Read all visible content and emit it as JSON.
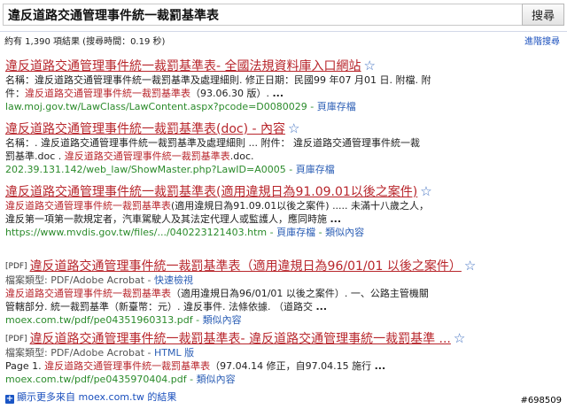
{
  "search": {
    "query": "違反道路交通管理事件統一裁罰基準表",
    "button_label": "搜尋"
  },
  "stats": {
    "text": "約有 1,390 項結果 (搜尋時間：0.19 秒)",
    "advanced_link": "進階搜尋"
  },
  "results": [
    {
      "title": "違反道路交通管理事件統一裁罰基準表- 全國法規資料庫入口網站",
      "lines": [
        {
          "parts": [
            {
              "t": "名稱：違反道路交通管理事件統一裁罰基準及處理細則. 修正日期：民國99 年07 月01 日. 附檔. 附",
              "c": ""
            }
          ]
        },
        {
          "parts": [
            {
              "t": "件：",
              "c": ""
            },
            {
              "t": "違反道路交通管理事件統一裁罰基準表",
              "c": "hl"
            },
            {
              "t": "（93.06.30 版）. ",
              "c": ""
            },
            {
              "t": "...",
              "c": "b"
            }
          ]
        }
      ],
      "url": "law.moj.gov.tw/LawClass/LawContent.aspx?pcode=D0080029",
      "actions": [
        "頁庫存檔"
      ]
    },
    {
      "title": "違反道路交通管理事件統一裁罰基準表(doc) - 內容",
      "lines": [
        {
          "parts": [
            {
              "t": "名稱：. 違反道路交通管理事件統一裁罰基準及處理細則 ... 附件： 違反道路交通管理事件統一裁",
              "c": ""
            }
          ]
        },
        {
          "parts": [
            {
              "t": "罰基準.doc . ",
              "c": ""
            },
            {
              "t": "違反道路交通管理事件統一裁罰基準表",
              "c": "hl"
            },
            {
              "t": ".doc.",
              "c": ""
            }
          ]
        }
      ],
      "url": "202.39.131.142/web_law/ShowMaster.php?LawID=A0005",
      "actions": [
        "頁庫存檔"
      ]
    },
    {
      "title": "違反道路交通管理事件統一裁罰基準表(適用違規日為91.09.01以後之案件)",
      "lines": [
        {
          "parts": [
            {
              "t": "違反道路交通管理事件統一裁罰基準表",
              "c": "hl"
            },
            {
              "t": "(適用違規日為91.09.01以後之案件) ..... 未滿十八歲之人，",
              "c": ""
            }
          ]
        },
        {
          "parts": [
            {
              "t": "違反第一項第一款規定者，汽車駕駛人及其法定代理人或監護人，應同時施 ",
              "c": ""
            },
            {
              "t": "...",
              "c": "b"
            }
          ]
        }
      ],
      "url": "https://www.mvdis.gov.tw/files/.../040223121403.htm",
      "actions": [
        "頁庫存檔",
        "類似內容"
      ]
    },
    {
      "pdf_tag": "[PDF]",
      "title": "違反道路交通管理事件統一裁罰基準表（適用違規日為96/01/01 以後之案件）",
      "filetype_label": "檔案類型: PDF/Adobe Acrobat - ",
      "filetype_link": "快速檢視",
      "lines": [
        {
          "parts": [
            {
              "t": "違反道路交通管理事件統一裁罰基準表",
              "c": "hl"
            },
            {
              "t": "（適用違規日為96/01/01 以後之案件）. 一、公路主管機關",
              "c": ""
            }
          ]
        },
        {
          "parts": [
            {
              "t": "管轄部分. 統一裁罰基準（新臺幣：元）. 違反事件. 法條依據. （道路交 ",
              "c": ""
            },
            {
              "t": "...",
              "c": "b"
            }
          ]
        }
      ],
      "url": "moex.com.tw/pdf/pe04351960313.pdf",
      "actions": [
        "類似內容"
      ]
    },
    {
      "pdf_tag": "[PDF]",
      "title": "違反道路交通管理事件統一裁罰基準表- 違反道路交通管理事統一裁罰基準 ...",
      "filetype_label": "檔案類型: PDF/Adobe Acrobat - ",
      "filetype_link": "HTML 版",
      "lines": [
        {
          "parts": [
            {
              "t": "Page 1. ",
              "c": ""
            },
            {
              "t": "違反道路交通管理事件統一裁罰基準表",
              "c": "hl"
            },
            {
              "t": "（97.04.14 修正，自97.04.15 施行 ",
              "c": ""
            },
            {
              "t": "...",
              "c": "b"
            }
          ]
        }
      ],
      "url": "moex.com.tw/pdf/pe0435970404.pdf",
      "actions": [
        "類似內容"
      ]
    }
  ],
  "more": {
    "icon": "plus-icon",
    "text": "顯示更多來自 moex.com.tw 的結果"
  },
  "watermark": "#698509",
  "colors": {
    "title": "#b8262c",
    "url": "#2b8b2b",
    "link": "#2b5eb5",
    "star": "#3f6fc0"
  }
}
